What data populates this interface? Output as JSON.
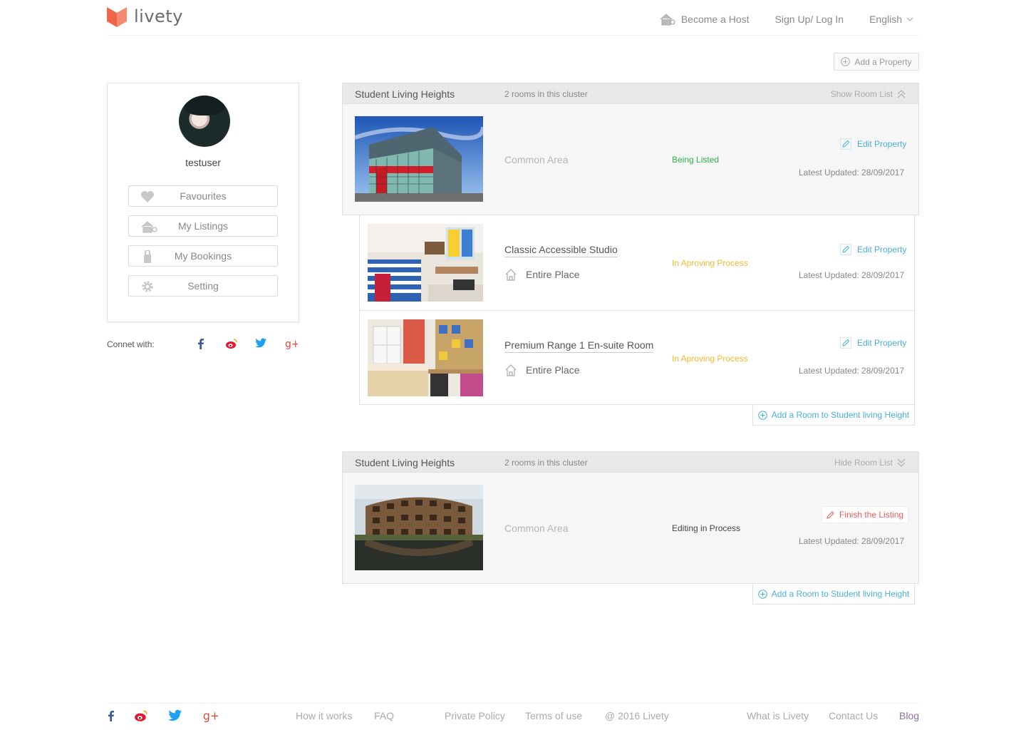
{
  "header": {
    "logo_text": "livety",
    "nav": {
      "become_host": "Become a Host",
      "sign_up": "Sign Up/ Log In",
      "language": "English"
    }
  },
  "add_property_label": "Add a Property",
  "profile": {
    "username": "testuser",
    "menu": [
      {
        "label": "Favourites",
        "icon": "heart-icon"
      },
      {
        "label": "My Listings",
        "icon": "house-icon"
      },
      {
        "label": "My Bookings",
        "icon": "lock-icon"
      },
      {
        "label": "Setting",
        "icon": "gear-icon"
      }
    ],
    "connect_label": "Connet with:"
  },
  "clusters": [
    {
      "title": "Student Living Heights",
      "count": "2 rooms in this cluster",
      "toggle": "Show Room List",
      "common": {
        "name": "Common Area",
        "status": "Being Listed",
        "action": "Edit Property",
        "updated": "Latest Updated: 28/09/2017"
      },
      "rooms": [
        {
          "title": "Classic Accessible Studio",
          "type": "Entire Place",
          "status": "In Aproving Process",
          "action": "Edit Property",
          "updated": "Latest Updated: 28/09/2017"
        },
        {
          "title": "Premium Range 1 En-suite Room",
          "type": "Entire Place",
          "status": "In Aproving Process",
          "action": "Edit Property",
          "updated": "Latest Updated: 28/09/2017"
        }
      ],
      "add_room": "Add a Room to Student living Height"
    },
    {
      "title": "Student Living Heights",
      "count": "2 rooms in this cluster",
      "toggle": "Hide Room List",
      "common": {
        "name": "Common Area",
        "status": "Editing in Process",
        "action": "Finish the Listing",
        "updated": "Latest Updated: 28/09/2017"
      },
      "add_room": "Add a Room to Student living Height"
    }
  ],
  "footer": {
    "links": [
      "How it works",
      "FAQ",
      "Private Policy",
      "Terms of use",
      "@ 2016 Livety",
      "What is Livety",
      "Contact Us",
      "Blog"
    ]
  },
  "colors": {
    "accent": "#4ab0d9",
    "brand": "#f0654a",
    "listed": "#2bb24c",
    "approving": "#f5b82e",
    "finish": "#e85c5c"
  }
}
